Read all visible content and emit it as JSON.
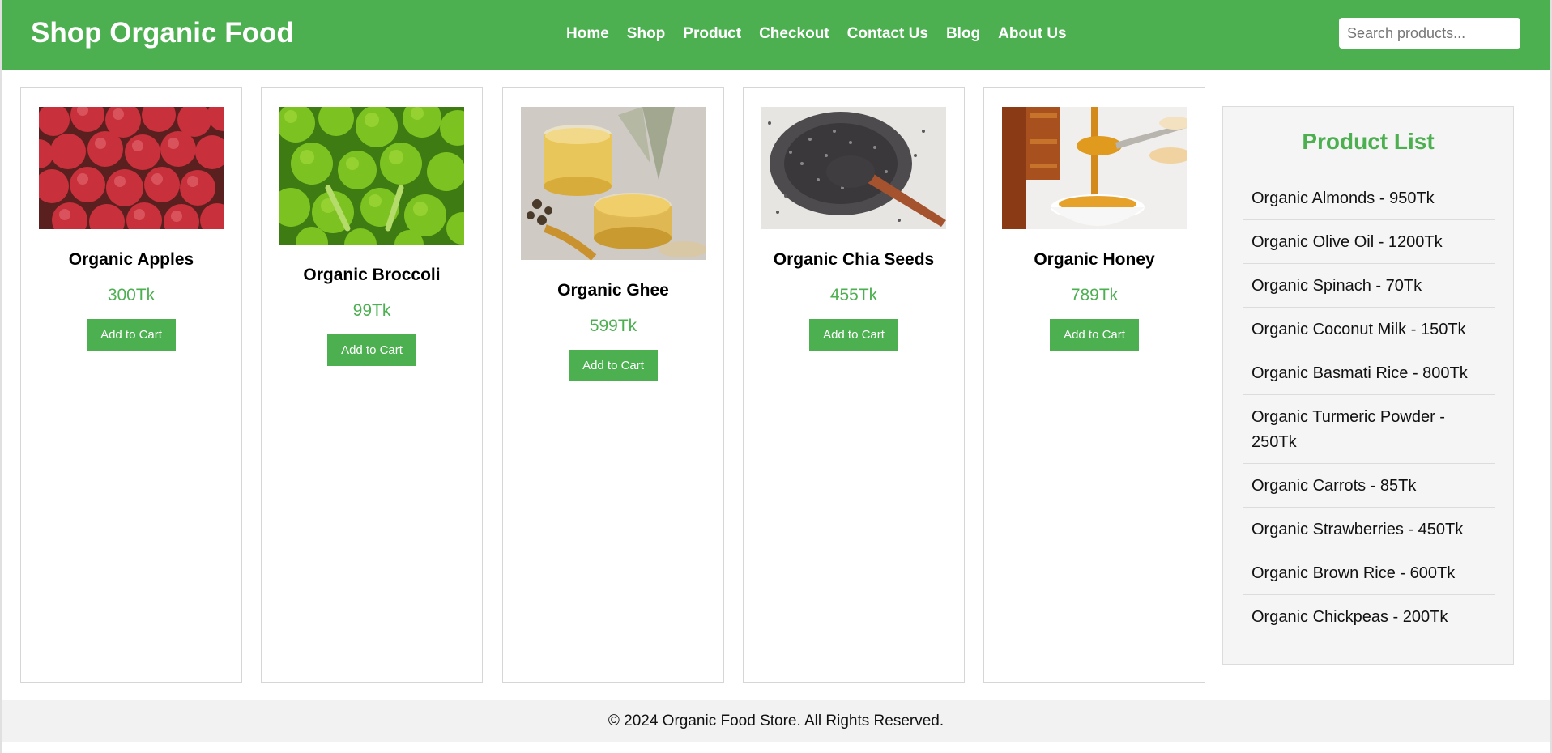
{
  "header": {
    "brand": "Shop Organic Food",
    "nav": [
      "Home",
      "Shop",
      "Product",
      "Checkout",
      "Contact Us",
      "Blog",
      "About Us"
    ],
    "search_placeholder": "Search products..."
  },
  "products": [
    {
      "name": "Organic Apples",
      "price": "300Tk",
      "button": "Add to Cart",
      "image_icon": "apples-image"
    },
    {
      "name": "Organic Broccoli",
      "price": "99Tk",
      "button": "Add to Cart",
      "image_icon": "broccoli-image"
    },
    {
      "name": "Organic Ghee",
      "price": "599Tk",
      "button": "Add to Cart",
      "image_icon": "ghee-image"
    },
    {
      "name": "Organic Chia Seeds",
      "price": "455Tk",
      "button": "Add to Cart",
      "image_icon": "chia-seeds-image"
    },
    {
      "name": "Organic Honey",
      "price": "789Tk",
      "button": "Add to Cart",
      "image_icon": "honey-image"
    }
  ],
  "sidebar": {
    "title": "Product List",
    "items": [
      "Organic Almonds - 950Tk",
      "Organic Olive Oil - 1200Tk",
      "Organic Spinach - 70Tk",
      "Organic Coconut Milk - 150Tk",
      "Organic Basmati Rice - 800Tk",
      "Organic Turmeric Powder - 250Tk",
      "Organic Carrots - 85Tk",
      "Organic Strawberries - 450Tk",
      "Organic Brown Rice - 600Tk",
      "Organic Chickpeas - 200Tk"
    ]
  },
  "footer": {
    "text": "© 2024 Organic Food Store. All Rights Reserved."
  },
  "colors": {
    "accent": "#4caf50",
    "footer_bg": "#f2f2f2",
    "sidebar_bg": "#f5f5f5"
  }
}
